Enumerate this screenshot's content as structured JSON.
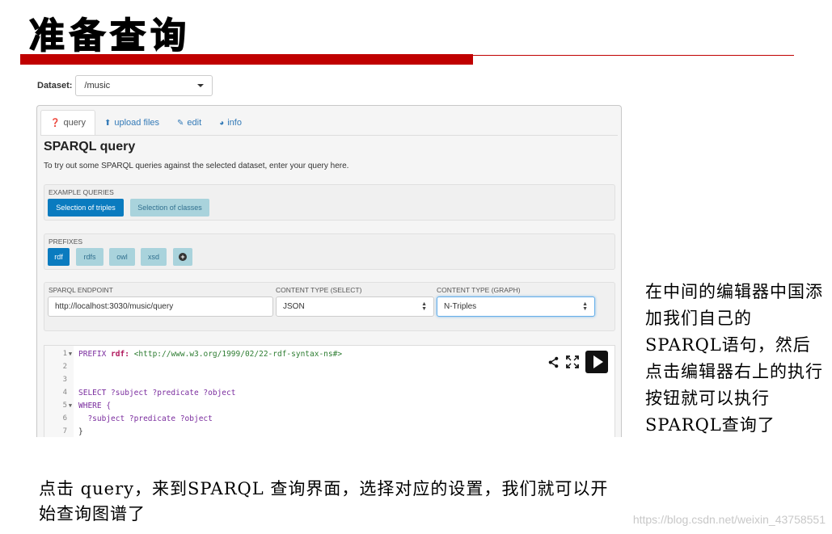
{
  "slide": {
    "title": "准备查询",
    "note_right": "在中间的编辑器中国添加我们自己的SPARQL语句，然后点击编辑器右上的执行按钮就可以执行SPARQL查询了",
    "note_bottom": "点击 query，来到SPARQL 查询界面，选择对应的设置，我们就可以开始查询图谱了",
    "watermark": "https://blog.csdn.net/weixin_43758551"
  },
  "dataset": {
    "label": "Dataset:",
    "value": "/music"
  },
  "tabs": [
    {
      "label": "query",
      "icon": "question-circle-icon"
    },
    {
      "label": "upload files",
      "icon": "upload-icon"
    },
    {
      "label": "edit",
      "icon": "edit-icon"
    },
    {
      "label": "info",
      "icon": "dashboard-icon"
    }
  ],
  "query_page": {
    "heading": "SPARQL query",
    "description": "To try out some SPARQL queries against the selected dataset, enter your query here."
  },
  "examples": {
    "label": "EXAMPLE QUERIES",
    "buttons": [
      "Selection of triples",
      "Selection of classes"
    ]
  },
  "prefixes": {
    "label": "PREFIXES",
    "buttons": [
      "rdf",
      "rdfs",
      "owl",
      "xsd"
    ],
    "add_icon": "plus-circle-icon"
  },
  "endpoint": {
    "endpoint_label": "SPARQL ENDPOINT",
    "endpoint_value": "http://localhost:3030/music/query",
    "select_label": "CONTENT TYPE (SELECT)",
    "select_value": "JSON",
    "graph_label": "CONTENT TYPE (GRAPH)",
    "graph_value": "N-Triples"
  },
  "editor": {
    "line_numbers": [
      "1",
      "2",
      "3",
      "4",
      "5",
      "6",
      "7"
    ],
    "line1_kw": "PREFIX",
    "line1_pfx": "rdf:",
    "line1_uri": "<http://www.w3.org/1999/02/22-rdf-syntax-ns#>",
    "line4": "SELECT ?subject ?predicate ?object",
    "line5": "WHERE {",
    "line6": "  ?subject ?predicate ?object",
    "line7": "}",
    "icons": [
      "share-icon",
      "fullscreen-icon",
      "run-query-icon"
    ]
  }
}
